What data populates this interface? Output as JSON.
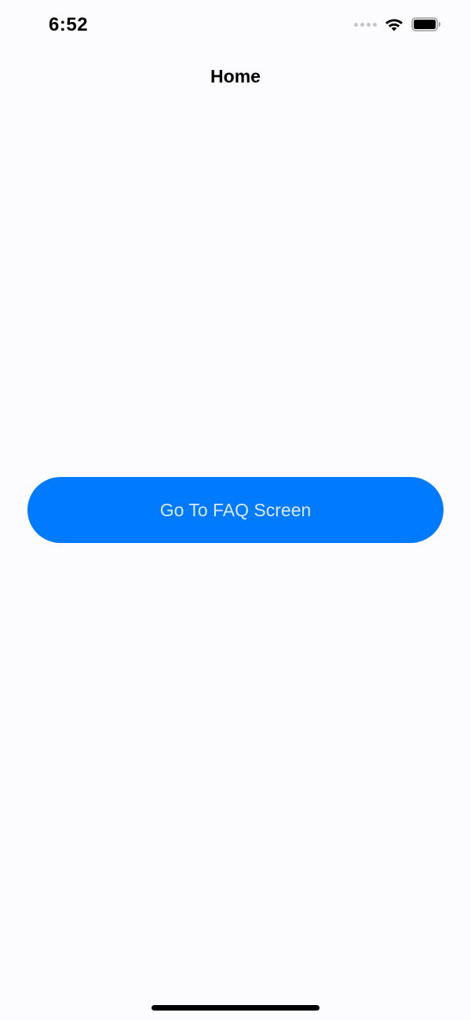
{
  "status_bar": {
    "time": "6:52",
    "icons": [
      "signal-dots-icon",
      "wifi-icon",
      "battery-icon"
    ]
  },
  "nav": {
    "title": "Home"
  },
  "main": {
    "button_label": "Go To FAQ Screen"
  },
  "colors": {
    "accent": "#007aff",
    "background": "#fcfbfe"
  }
}
